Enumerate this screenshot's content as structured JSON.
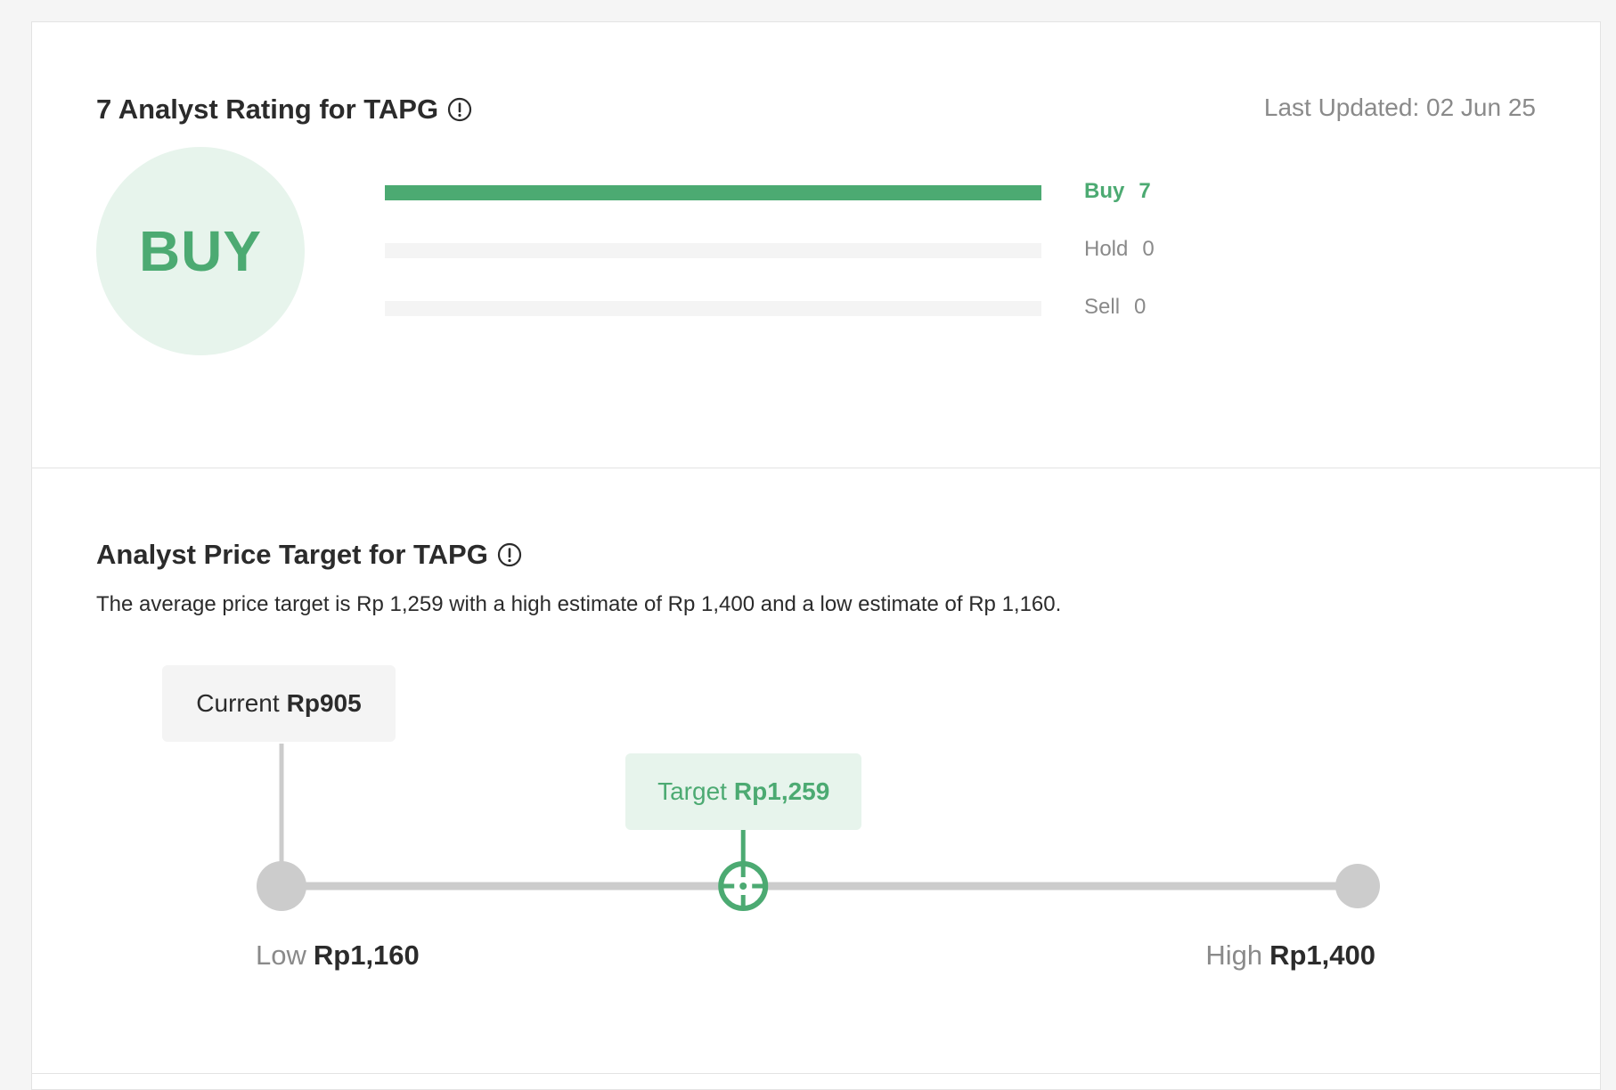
{
  "rating": {
    "title": "7 Analyst Rating for TAPG",
    "last_updated": "Last Updated: 02 Jun 25",
    "consensus": "BUY",
    "bars": [
      {
        "label": "Buy",
        "count": "7",
        "fraction": 1.0,
        "active": true
      },
      {
        "label": "Hold",
        "count": "0",
        "fraction": 0.0,
        "active": false
      },
      {
        "label": "Sell",
        "count": "0",
        "fraction": 0.0,
        "active": false
      }
    ]
  },
  "price_target": {
    "title": "Analyst Price Target for TAPG",
    "summary": "The average price target is Rp 1,259 with a high estimate of Rp 1,400 and a low estimate of Rp 1,160.",
    "current": {
      "word": "Current",
      "value": "Rp905"
    },
    "target": {
      "word": "Target",
      "value": "Rp1,259"
    },
    "low": {
      "word": "Low",
      "value": "Rp1,160"
    },
    "high": {
      "word": "High",
      "value": "Rp1,400"
    },
    "target_position_fraction": 0.429
  },
  "colors": {
    "accent": "#4caa72",
    "accent_light": "#e7f4ec",
    "track": "#cccccc",
    "muted_text": "#8a8a8a"
  },
  "icons": {
    "info": "info-circle-icon",
    "target_marker": "crosshair-icon"
  }
}
